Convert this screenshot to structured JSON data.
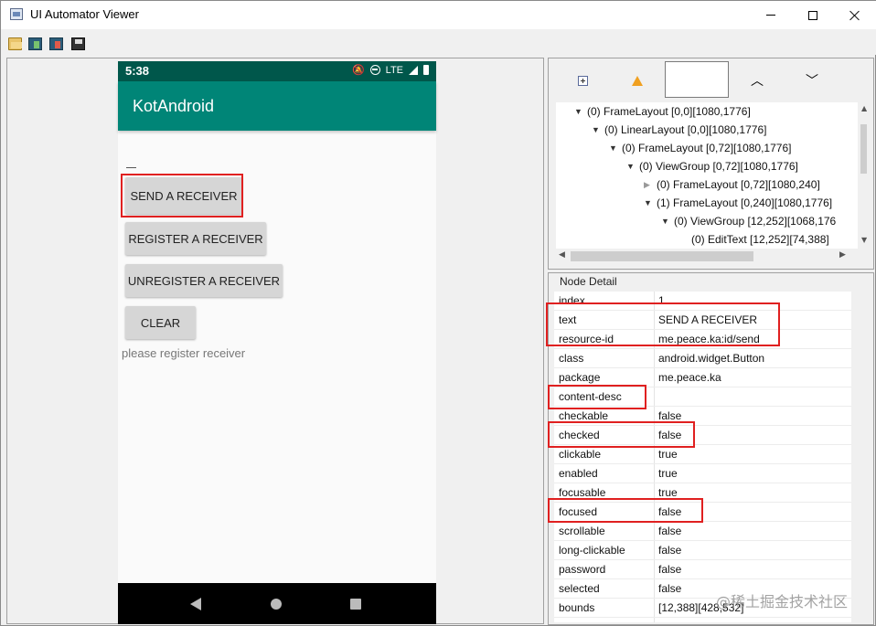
{
  "window": {
    "title": "UI Automator Viewer"
  },
  "device": {
    "status_time": "5:38",
    "network": "LTE",
    "app_title": "KotAndroid",
    "buttons": {
      "send": "SEND A RECEIVER",
      "register": "REGISTER A RECEIVER",
      "unregister": "UNREGISTER A RECEIVER",
      "clear": "CLEAR"
    },
    "status_text": "please register receiver"
  },
  "hierarchy": {
    "rows": [
      "(0) FrameLayout [0,0][1080,1776]",
      "(0) LinearLayout [0,0][1080,1776]",
      "(0) FrameLayout [0,72][1080,1776]",
      "(0) ViewGroup [0,72][1080,1776]",
      "(0) FrameLayout [0,72][1080,240]",
      "(1) FrameLayout [0,240][1080,1776]",
      "(0) ViewGroup [12,252][1068,176",
      "(0) EditText [12,252][74,388]"
    ]
  },
  "node_detail": {
    "title": "Node Detail",
    "rows": [
      {
        "key": "index",
        "value": "1"
      },
      {
        "key": "text",
        "value": "SEND A RECEIVER"
      },
      {
        "key": "resource-id",
        "value": "me.peace.ka:id/send"
      },
      {
        "key": "class",
        "value": "android.widget.Button"
      },
      {
        "key": "package",
        "value": "me.peace.ka"
      },
      {
        "key": "content-desc",
        "value": ""
      },
      {
        "key": "checkable",
        "value": "false"
      },
      {
        "key": "checked",
        "value": "false"
      },
      {
        "key": "clickable",
        "value": "true"
      },
      {
        "key": "enabled",
        "value": "true"
      },
      {
        "key": "focusable",
        "value": "true"
      },
      {
        "key": "focused",
        "value": "false"
      },
      {
        "key": "scrollable",
        "value": "false"
      },
      {
        "key": "long-clickable",
        "value": "false"
      },
      {
        "key": "password",
        "value": "false"
      },
      {
        "key": "selected",
        "value": "false"
      },
      {
        "key": "bounds",
        "value": "[12,388][428,532]"
      }
    ]
  },
  "watermark": "@稀土掘金技术社区",
  "colors": {
    "status_bar": "#00574b",
    "app_bar": "#008577",
    "highlight": "#e02020"
  }
}
